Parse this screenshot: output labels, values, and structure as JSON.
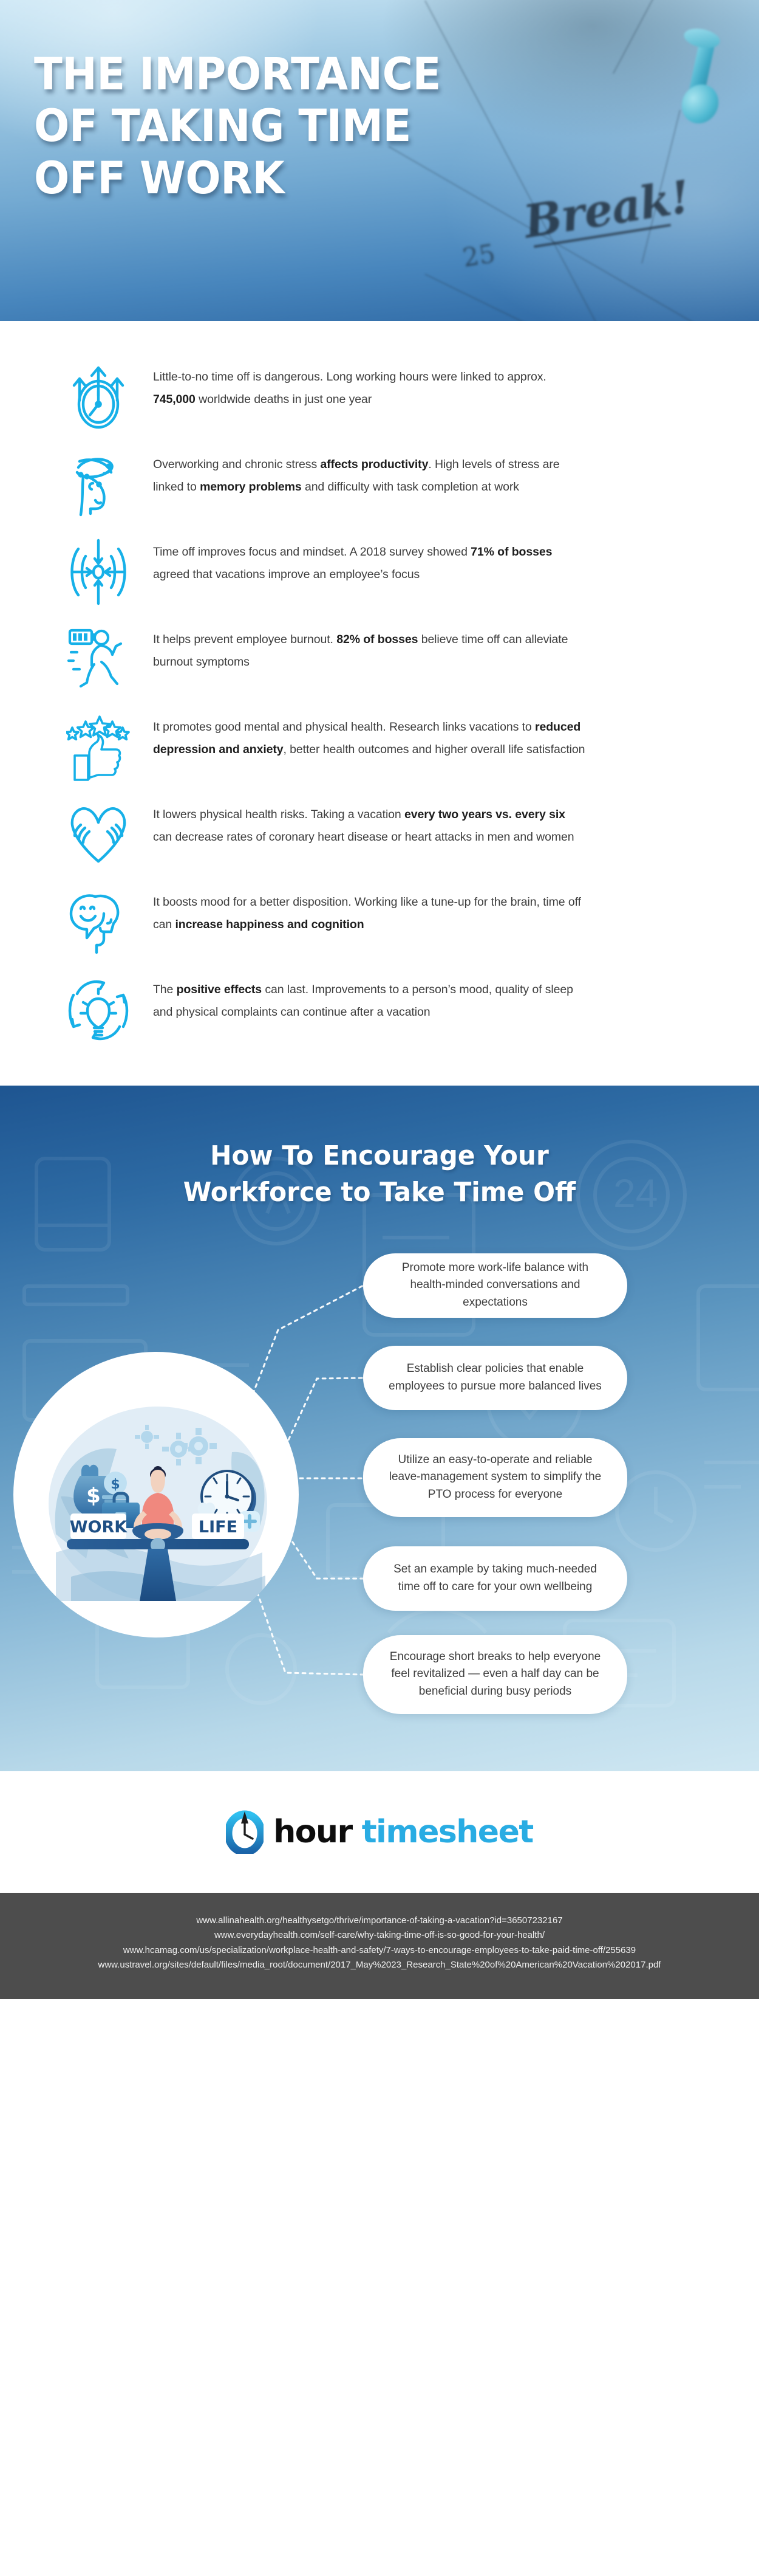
{
  "header": {
    "title": "THE IMPORTANCE OF TAKING TIME OFF WORK",
    "photo_text_break": "Break",
    "photo_text_bang": "!",
    "photo_text_day": "25"
  },
  "benefits": [
    {
      "icon": "clock-with-rising-arrows-icon",
      "parts": [
        {
          "t": "Little-to-no time off is dangerous. Long working hours were linked to approx. ",
          "b": false
        },
        {
          "t": "745,000",
          "b": true
        },
        {
          "t": " worldwide deaths in just one year",
          "b": false
        }
      ]
    },
    {
      "icon": "dizzy-head-stress-icon",
      "parts": [
        {
          "t": "Overworking and chronic stress ",
          "b": false
        },
        {
          "t": "affects productivity",
          "b": true
        },
        {
          "t": ". High levels of stress are linked to ",
          "b": false
        },
        {
          "t": "memory problems",
          "b": true
        },
        {
          "t": " and difficulty with task completion at work",
          "b": false
        }
      ]
    },
    {
      "icon": "focus-target-icon",
      "parts": [
        {
          "t": "Time off improves focus and mindset. A 2018 survey showed ",
          "b": false
        },
        {
          "t": "71% of bosses",
          "b": true
        },
        {
          "t": " agreed that vacations improve an employee’s focus",
          "b": false
        }
      ]
    },
    {
      "icon": "running-person-battery-icon",
      "parts": [
        {
          "t": "It helps prevent employee burnout. ",
          "b": false
        },
        {
          "t": "82% of bosses",
          "b": true
        },
        {
          "t": " believe time off can alleviate burnout symptoms",
          "b": false
        }
      ]
    },
    {
      "icon": "thumbs-up-five-stars-icon",
      "parts": [
        {
          "t": "It promotes good mental and physical health. Research links vacations to ",
          "b": false
        },
        {
          "t": "reduced depression and anxiety",
          "b": true
        },
        {
          "t": ", better health outcomes and higher overall life satisfaction",
          "b": false
        }
      ]
    },
    {
      "icon": "heart-of-hands-icon",
      "parts": [
        {
          "t": "It lowers physical health risks. Taking a vacation ",
          "b": false
        },
        {
          "t": "every two years vs. every six",
          "b": true
        },
        {
          "t": " can decrease rates of coronary heart disease or heart attacks in men and women",
          "b": false
        }
      ]
    },
    {
      "icon": "smiley-face-profile-icon",
      "parts": [
        {
          "t": "It boosts mood for a better disposition. Working like a tune-up for the brain, time off can ",
          "b": false
        },
        {
          "t": "increase happiness and cognition",
          "b": true
        }
      ]
    },
    {
      "icon": "lightbulb-refresh-cycle-icon",
      "parts": [
        {
          "t": "The ",
          "b": false
        },
        {
          "t": "positive effects",
          "b": true
        },
        {
          "t": " can last. Improvements to a person’s mood, quality of sleep and physical complaints can continue after a vacation",
          "b": false
        }
      ]
    }
  ],
  "encourage_section": {
    "title_line1": "How To Encourage Your",
    "title_line2": "Workforce to Take Time Off",
    "illustration": {
      "name": "work-life-balance-scale-illustration",
      "left_label": "WORK",
      "right_label": "LIFE",
      "money_symbol": "$"
    },
    "tips": [
      "Promote more work-life balance with health-minded conversations and expectations",
      "Establish clear policies that enable employees to pursue more balanced lives",
      "Utilize an easy-to-operate and reliable leave-management system to simplify the PTO process for everyone",
      "Set an example by taking much-needed time off to care for your own wellbeing",
      "Encourage short breaks to help everyone feel revitalized — even a half day can be beneficial during busy periods"
    ]
  },
  "logo": {
    "icon": "clock-ring-logo-icon",
    "word_1": "hour",
    "word_2": "timesheet"
  },
  "footer": {
    "sources": [
      "www.allinahealth.org/healthysetgo/thrive/importance-of-taking-a-vacation?id=36507232167",
      "www.everydayhealth.com/self-care/why-taking-time-off-is-so-good-for-your-health/",
      "www.hcamag.com/us/specialization/workplace-health-and-safety/7-ways-to-encourage-employees-to-take-paid-time-off/255639",
      "www.ustravel.org/sites/default/files/media_root/document/2017_May%2023_Research_State%20of%20American%20Vacation%202017.pdf"
    ]
  },
  "colors": {
    "accent_cyan": "#16b0e8",
    "deep_blue": "#1e5591",
    "brand_blue": "#29ace3",
    "footer_gray": "#4d4d4d"
  }
}
